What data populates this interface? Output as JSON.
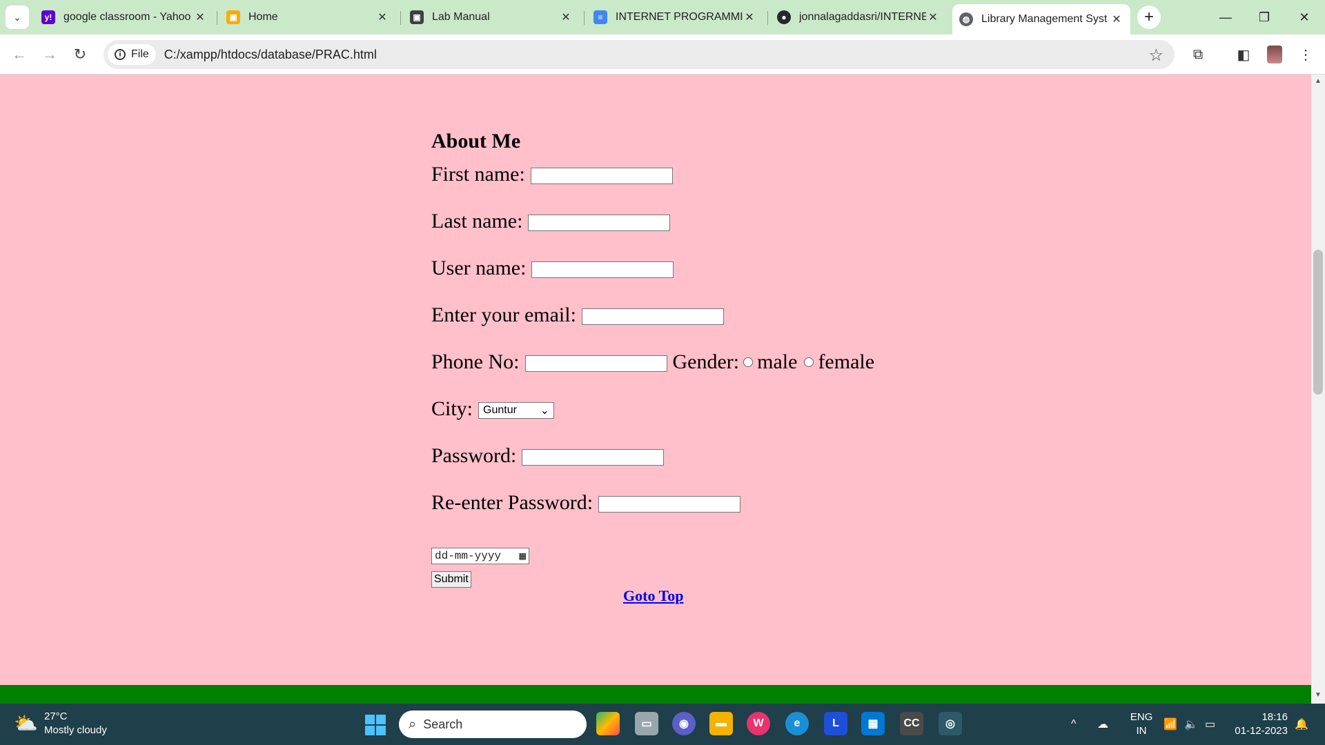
{
  "browser": {
    "tabs": [
      {
        "title": "google classroom - Yahoo",
        "icon": "yahoo-icon",
        "color": "#6001d2",
        "glyph": "y!"
      },
      {
        "title": "Home",
        "icon": "classroom-icon",
        "color": "#f9ab00",
        "glyph": "▣"
      },
      {
        "title": "Lab Manual",
        "icon": "classroom-dark-icon",
        "color": "#3c4043",
        "glyph": "▣"
      },
      {
        "title": "INTERNET PROGRAMMIN",
        "icon": "docs-icon",
        "color": "#4285f4",
        "glyph": "≡"
      },
      {
        "title": "jonnalagaddasri/INTERNE",
        "icon": "github-icon",
        "color": "#24292f",
        "glyph": "●"
      },
      {
        "title": "Library Management Syst",
        "icon": "globe-icon",
        "color": "#5f6368",
        "glyph": "◍"
      }
    ],
    "address": {
      "chip_label": "File",
      "url": "C:/xampp/htdocs/database/PRAC.html"
    }
  },
  "page": {
    "background": "#ffc0cb",
    "heading": "About Me",
    "labels": {
      "first_name": "First name:",
      "last_name": "Last name:",
      "user_name": "User name:",
      "email": "Enter your email:",
      "phone": "Phone No:",
      "gender": "Gender:",
      "male": "male",
      "female": "female",
      "city": "City:",
      "password": "Password:",
      "reenter": "Re-enter Password:"
    },
    "city_selected": "Guntur",
    "date_placeholder": "dd-mm-yyyy",
    "submit_label": "Submit",
    "goto_top": "Goto Top",
    "footer_color": "#008000"
  },
  "taskbar": {
    "weather_temp": "27°C",
    "weather_desc": "Mostly cloudy",
    "search_placeholder": "Search",
    "language_line1": "ENG",
    "language_line2": "IN",
    "time": "18:16",
    "date": "01-12-2023"
  }
}
